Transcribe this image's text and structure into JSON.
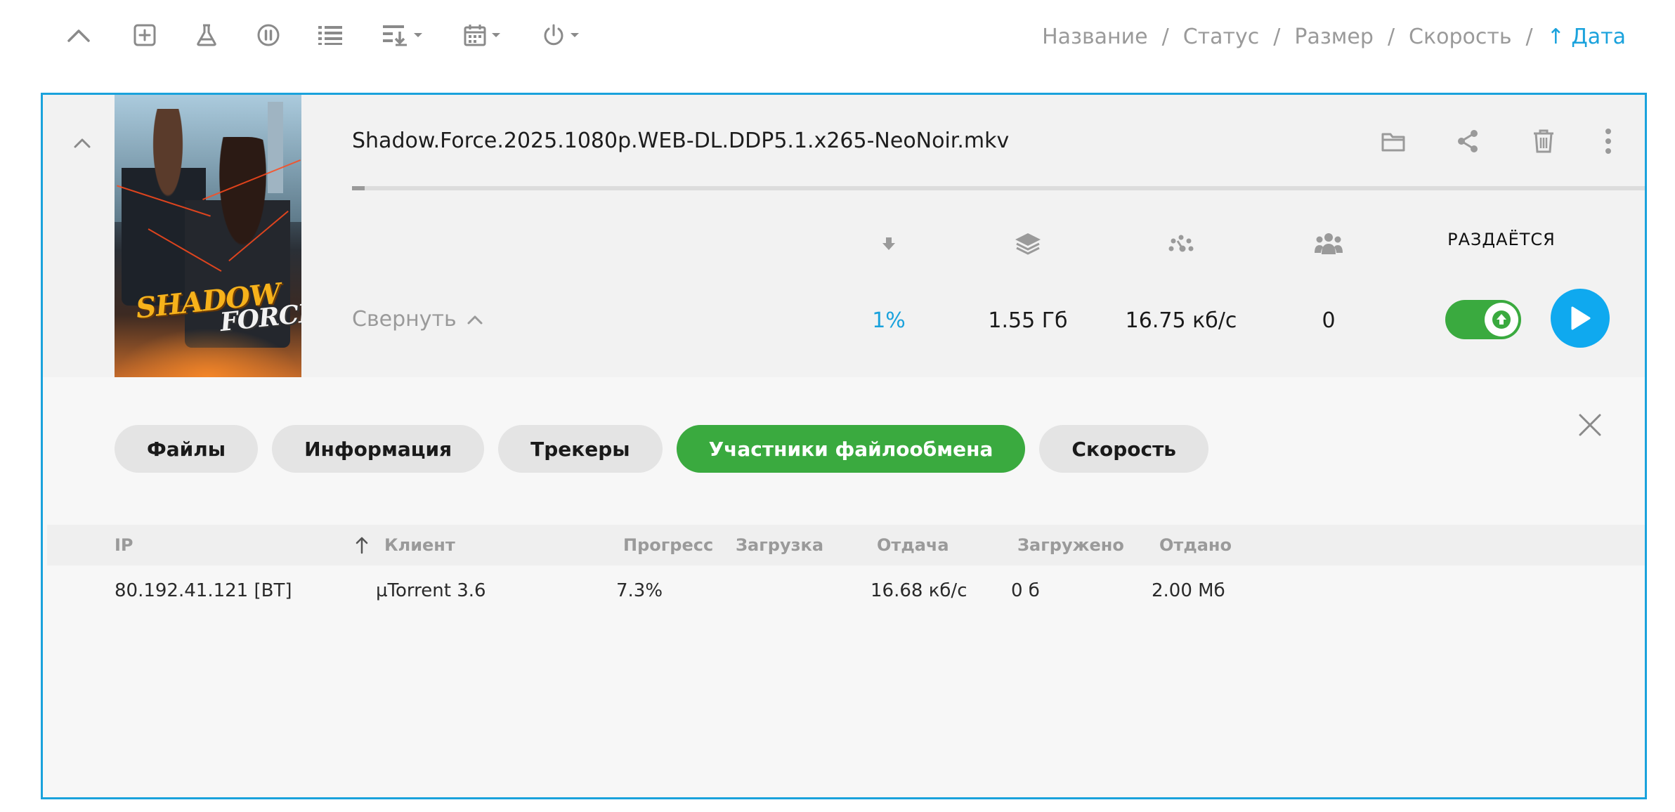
{
  "toolbar": {
    "icons": [
      "chevron-up-icon",
      "add-torrent-icon",
      "flask-icon",
      "pause-icon",
      "list-icon",
      "sort-download-icon",
      "calendar-icon",
      "power-icon"
    ],
    "sort": {
      "name": "Название",
      "status": "Статус",
      "size": "Размер",
      "speed": "Скорость",
      "date": "↑ Дата",
      "separator": "/"
    }
  },
  "torrent": {
    "poster_title_line1": "SHADOW",
    "poster_title_line2": "FORCE",
    "file_name": "Shadow.Force.2025.1080p.WEB-DL.DDP5.1.x265-NeoNoir.mkv",
    "progress_fraction": 0.01,
    "state_label": "РАЗДАЁТСЯ",
    "collapse_label": "Свернуть",
    "stats": {
      "progress": "1%",
      "size": "1.55 Гб",
      "speed": "16.75 кб/с",
      "peers": "0"
    },
    "seeding_enabled": true,
    "accent_color": "#1aa2dc",
    "active_color": "#3aaa3f"
  },
  "tabs": [
    {
      "label": "Файлы",
      "active": false
    },
    {
      "label": "Информация",
      "active": false
    },
    {
      "label": "Трекеры",
      "active": false
    },
    {
      "label": "Участники файлообмена",
      "active": true
    },
    {
      "label": "Скорость",
      "active": false
    }
  ],
  "peers_table": {
    "columns": {
      "ip": "IP",
      "client": "Клиент",
      "progress": "Прогресс",
      "download": "Загрузка",
      "upload": "Отдача",
      "downloaded": "Загружено",
      "uploaded": "Отдано"
    },
    "rows": [
      {
        "ip": "80.192.41.121 [BT]",
        "client": "µTorrent 3.6",
        "progress": "7.3%",
        "download": "",
        "upload": "16.68 кб/с",
        "downloaded": "0 б",
        "uploaded": "2.00 Мб"
      }
    ]
  }
}
